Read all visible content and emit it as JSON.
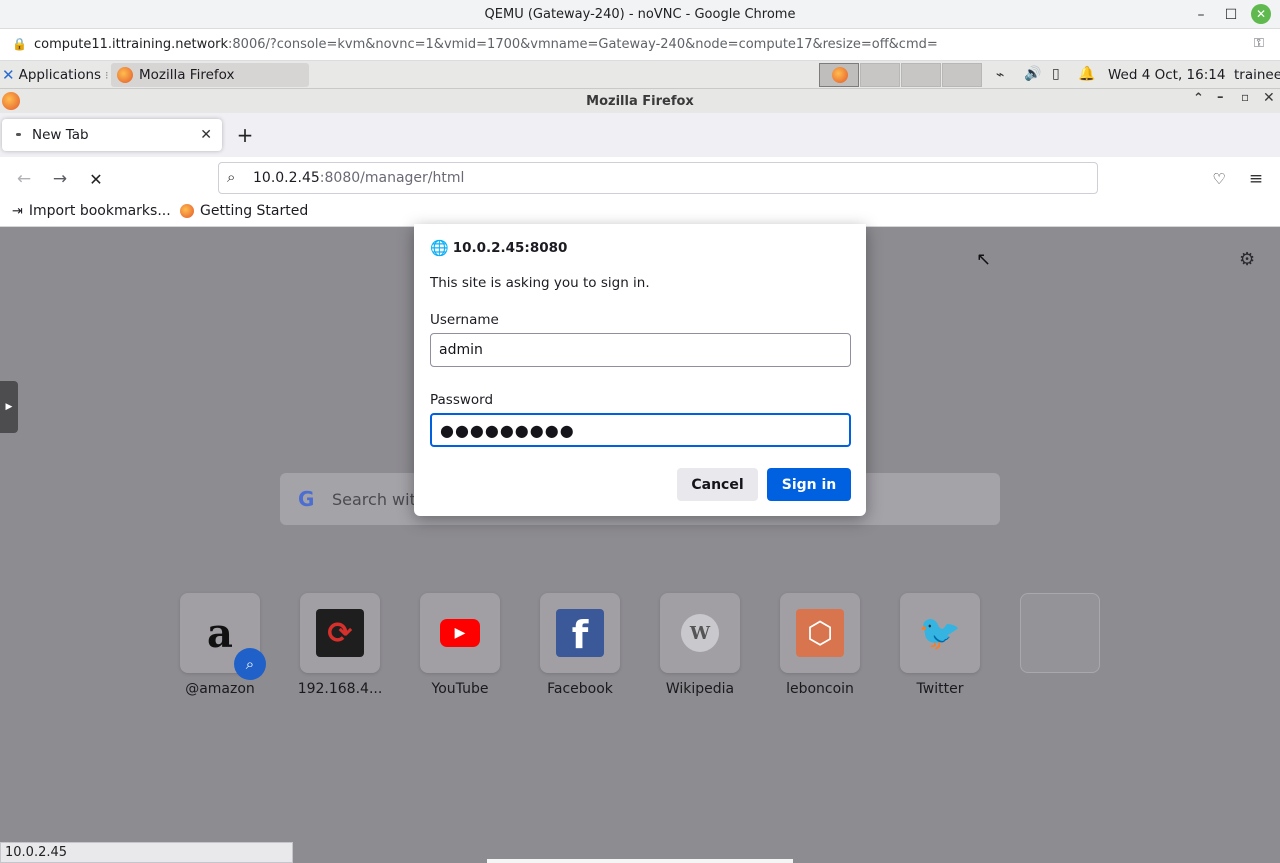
{
  "chrome": {
    "title": "QEMU (Gateway-240) - noVNC - Google Chrome",
    "url_host": "compute11.ittraining.network",
    "url_rest": ":8006/?console=kvm&novnc=1&vmid=1700&vmname=Gateway-240&node=compute17&resize=off&cmd="
  },
  "panel": {
    "apps_label": "Applications",
    "taskbar_item": "Mozilla Firefox",
    "clock": "Wed  4 Oct, 16:14",
    "user": "trainee"
  },
  "firefox": {
    "window_title": "Mozilla Firefox",
    "tab_label": "New Tab",
    "url_host": "10.0.2.45",
    "url_path": ":8080/manager/html",
    "bookmarks": [
      "Import bookmarks...",
      "Getting Started"
    ]
  },
  "content": {
    "search_placeholder": "Search wit",
    "tiles": [
      {
        "label": "@amazon",
        "color": "#ffffff"
      },
      {
        "label": "192.168.4...",
        "color": "#1e1e1e"
      },
      {
        "label": "YouTube",
        "color": "#ff0000"
      },
      {
        "label": "Facebook",
        "color": "#3b5998"
      },
      {
        "label": "Wikipedia",
        "color": "#cfcfcf"
      },
      {
        "label": "leboncoin",
        "color": "#ee7148"
      },
      {
        "label": "Twitter",
        "color": "#1da1f2"
      },
      {
        "label": "",
        "color": "#a19fa4"
      }
    ]
  },
  "dialog": {
    "host": "10.0.2.45:8080",
    "message": "This site is asking you to sign in.",
    "username_label": "Username",
    "username_value": "admin",
    "password_label": "Password",
    "password_mask": "●●●●●●●●●",
    "cancel_label": "Cancel",
    "signin_label": "Sign in"
  },
  "status": {
    "text": "10.0.2.45"
  }
}
